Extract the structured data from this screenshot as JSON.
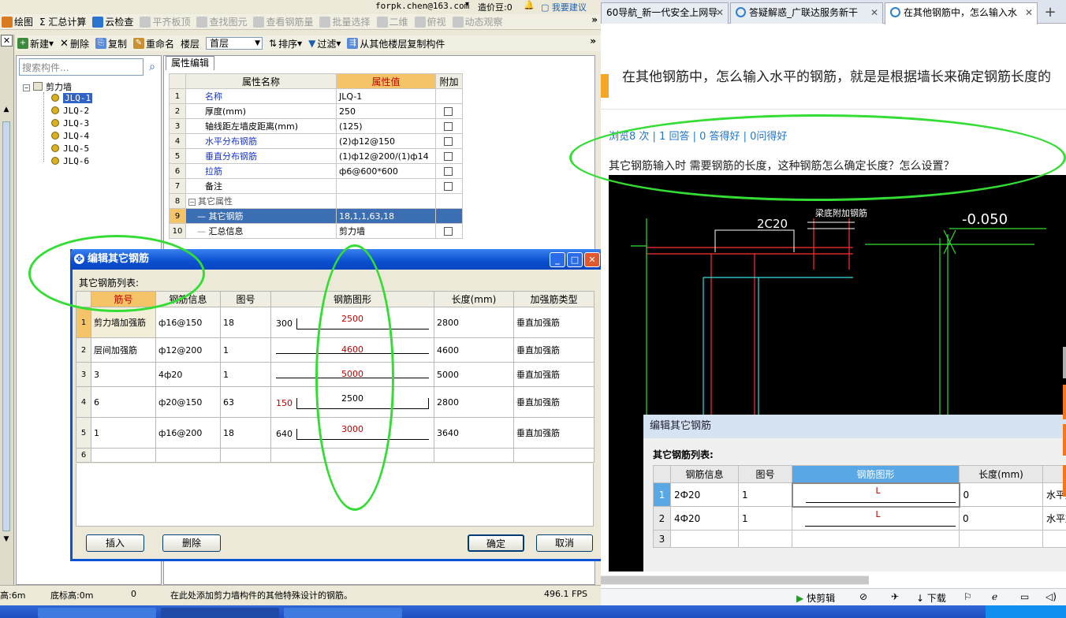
{
  "app": {
    "top_strip": {
      "email": "forpk.chen@163.com",
      "zaojia": "造价豆:0",
      "suggest": "我要建议"
    },
    "toolbar1": [
      {
        "label": "绘图",
        "enabled": true,
        "icon": "draw-icon"
      },
      {
        "label": "Σ 汇总计算",
        "enabled": true,
        "icon": "sum-icon"
      },
      {
        "label": "云检查",
        "enabled": true,
        "icon": "cloud-check-icon"
      },
      {
        "label": "平齐板顶",
        "enabled": false,
        "icon": "align-icon"
      },
      {
        "label": "查找图元",
        "enabled": false,
        "icon": "find-icon"
      },
      {
        "label": "查看钢筋量",
        "enabled": false,
        "icon": "view-rebar-icon"
      },
      {
        "label": "批量选择",
        "enabled": false,
        "icon": "batch-select-icon"
      },
      {
        "label": "二维",
        "enabled": false,
        "icon": "2d-icon"
      },
      {
        "label": "俯视",
        "enabled": false,
        "icon": "top-view-icon"
      },
      {
        "label": "动态观察",
        "enabled": false,
        "icon": "orbit-icon"
      }
    ],
    "toolbar2": {
      "new": "新建",
      "delete": "删除",
      "copy": "复制",
      "rename": "重命名",
      "floor_label": "楼层",
      "floor_value": "首层",
      "sort": "排序",
      "filter": "过滤",
      "copy_from": "从其他楼层复制构件"
    },
    "search_placeholder": "搜索构件...",
    "tree": {
      "root": "剪力墙",
      "items": [
        "JLQ-1",
        "JLQ-2",
        "JLQ-3",
        "JLQ-4",
        "JLQ-5",
        "JLQ-6"
      ]
    },
    "props": {
      "tab": "属性编辑",
      "headers": [
        "属性名称",
        "属性值",
        "附加"
      ],
      "rows": [
        {
          "n": "1",
          "name": "名称",
          "value": "JLQ-1",
          "blue": true,
          "check": false
        },
        {
          "n": "2",
          "name": "厚度(mm)",
          "value": "250",
          "blue": false,
          "check": true
        },
        {
          "n": "3",
          "name": "轴线距左墙皮距离(mm)",
          "value": "(125)",
          "blue": false,
          "check": true
        },
        {
          "n": "4",
          "name": "水平分布钢筋",
          "value": "(2)ф12@150",
          "blue": true,
          "check": true
        },
        {
          "n": "5",
          "name": "垂直分布钢筋",
          "value": "(1)ф12@200/(1)ф14",
          "blue": true,
          "check": true
        },
        {
          "n": "6",
          "name": "拉筋",
          "value": "ф6@600*600",
          "blue": true,
          "check": true
        },
        {
          "n": "7",
          "name": "备注",
          "value": "",
          "blue": false,
          "check": true
        },
        {
          "n": "8",
          "name": "其它属性",
          "value": "",
          "blue": false,
          "check": false,
          "group": true
        },
        {
          "n": "9",
          "name": "其它钢筋",
          "value": "18,1,1,63,18",
          "blue": false,
          "check": false,
          "selected": true
        },
        {
          "n": "10",
          "name": "汇总信息",
          "value": "剪力墙",
          "blue": false,
          "check": true
        }
      ]
    },
    "status": {
      "height": "高:6m",
      "base": "底标高:0m",
      "zero": "0",
      "hint": "在此处添加剪力墙构件的其他特殊设计的钢筋。",
      "fps": "496.1 FPS"
    }
  },
  "dialog": {
    "title": "编辑其它钢筋",
    "list_label": "其它钢筋列表:",
    "headers": [
      "筋号",
      "钢筋信息",
      "图号",
      "钢筋图形",
      "长度(mm)",
      "加强筋类型"
    ],
    "rows": [
      {
        "n": "1",
        "name": "剪力墙加强筋",
        "info": "ф16@150",
        "fig": "18",
        "left": "300",
        "mid": "2500",
        "length": "2800",
        "type": "垂直加强筋",
        "shape": "hook-left"
      },
      {
        "n": "2",
        "name": "层间加强筋",
        "info": "ф12@200",
        "fig": "1",
        "left": "",
        "mid": "4600",
        "length": "4600",
        "type": "垂直加强筋",
        "shape": "straight"
      },
      {
        "n": "3",
        "name": "3",
        "info": "4ф20",
        "fig": "1",
        "left": "",
        "mid": "5000",
        "length": "5000",
        "type": "垂直加强筋",
        "shape": "straight"
      },
      {
        "n": "4",
        "name": "6",
        "info": "ф20@150",
        "fig": "63",
        "left": "150",
        "mid": "2500",
        "length": "2800",
        "type": "垂直加强筋",
        "shape": "both"
      },
      {
        "n": "5",
        "name": "1",
        "info": "ф16@200",
        "fig": "18",
        "left": "640",
        "mid": "3000",
        "length": "3640",
        "type": "垂直加强筋",
        "shape": "hook-left"
      },
      {
        "n": "6",
        "name": "",
        "info": "",
        "fig": "",
        "left": "",
        "mid": "",
        "length": "",
        "type": "",
        "shape": "none"
      }
    ],
    "buttons": {
      "insert": "插入",
      "delete": "删除",
      "ok": "确定",
      "cancel": "取消"
    }
  },
  "browser": {
    "tabs": [
      "60导航_新一代安全上网导",
      "答疑解惑_广联达服务新干",
      "在其他钢筋中，怎么输入水"
    ],
    "question_title": "在其他钢筋中，怎么输入水平的钢筋，就是是根据墙长来确定钢筋长度的",
    "stats": "浏览8 次 | 1 回答 | 0 答得好 | 0问得好",
    "body": "其它钢筋输入时 需要钢筋的长度，这种钢筋怎么确定长度？怎么设置？",
    "cad": {
      "label1": "2C20",
      "label2": "梁底附加钢筋",
      "elevation": "-0.050"
    },
    "inner_dialog": {
      "title": "编辑其它钢筋",
      "list_label": "其它钢筋列表:",
      "headers": [
        "钢筋信息",
        "图号",
        "钢筋图形",
        "长度(mm)"
      ],
      "rows": [
        {
          "n": "1",
          "info": "2Ф20",
          "fig": "1",
          "shape": "L",
          "length": "0",
          "type": "水平加"
        },
        {
          "n": "2",
          "info": "4Ф20",
          "fig": "1",
          "shape": "L",
          "length": "0",
          "type": "水平加"
        },
        {
          "n": "3",
          "info": "",
          "fig": "",
          "shape": "",
          "length": "",
          "type": ""
        }
      ]
    },
    "bottom": {
      "clip": "快剪辑",
      "download": "下载"
    }
  }
}
